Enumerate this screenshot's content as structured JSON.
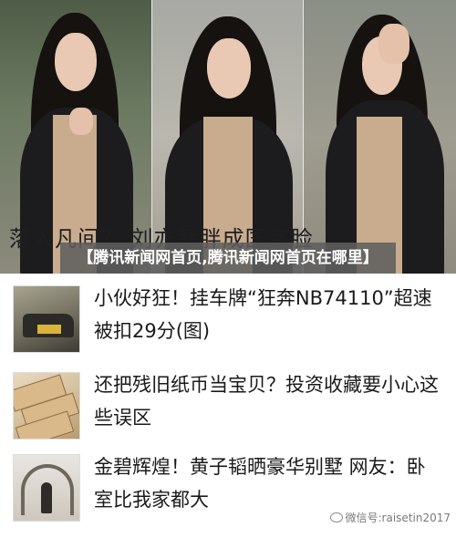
{
  "hero": {
    "caption": "落入凡间？ 刘亦菲胖成国字脸"
  },
  "overlay": {
    "title": "【腾讯新闻网首页,腾讯新闻网首页在哪里】"
  },
  "news": [
    {
      "title": "小伙好狂！挂车牌“狂奔NB74110”超速被扣29分(图)"
    },
    {
      "title": "还把残旧纸币当宝贝？投资收藏要小心这些误区"
    },
    {
      "title": "金碧辉煌！黄子韬晒豪华别墅 网友：卧室比我家都大"
    }
  ],
  "watermark": {
    "text": "微信号:raisetin2017",
    "icon": "wechat-icon"
  }
}
